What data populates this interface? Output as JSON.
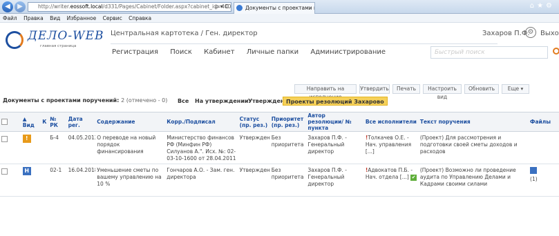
{
  "browser": {
    "url_prefix": "http://writer.",
    "url_domain": "eossoft.local",
    "url_rest": "/d331/Pages/Cabinet/Folder.aspx?cabinet_id=4000&card_id=0.8fc",
    "addr_icons": "ρ ▾ C",
    "tab_title": "Документы с проектами п...",
    "tab_close": "×",
    "tool_icons": "⌂★⚙"
  },
  "menu": [
    "Файл",
    "Правка",
    "Вид",
    "Избранное",
    "Сервис",
    "Справка"
  ],
  "header": {
    "logo_text": "ДЕЛО-WEB",
    "logo_sub": "главная страница",
    "card_title": "Центральная картотека / Ген. директор",
    "user_name": "Захаров П.Ф.",
    "exit_label": "Выход",
    "gear_glyph": "⚙",
    "nav": [
      "Регистрация",
      "Поиск",
      "Кабинет",
      "Личные папки",
      "Администрирование"
    ],
    "search_placeholder": "Быстрый поиск"
  },
  "actions": [
    "Направить на исполнение",
    "Утвердить",
    "Печать",
    "Настроить вид",
    "Обновить",
    "Еще ▾"
  ],
  "doc_bar": {
    "title": "Документы с проектами поручений:",
    "count": "2 (отмечено - 0)",
    "filters": [
      "Все",
      "На утверждении",
      "Утверждено",
      "Проекты резолюций Захарово"
    ]
  },
  "table": {
    "columns": [
      "",
      "▲ Вид",
      "К",
      "№ РК",
      "Дата рег.",
      "Содержание",
      "Корр./Подписал",
      "Статус (пр. рез.)",
      "Приоритет (пр. рез.)",
      "Автор резолюции/ № пункта",
      "Все исполнители",
      "Текст поручения",
      "Файлы"
    ],
    "rows": [
      {
        "icon": "!",
        "k": "",
        "rk": "Б-4",
        "date": "04.05.2012",
        "content": "О переводе на новый порядок финансирования",
        "corr": "Министерство финансов РФ (Минфин РФ) Силуанов А.\". Исх. №: 02-03-10-1600 от 28.04.2011",
        "status": "Утвержден",
        "priority": "Без приоритета",
        "author": "Захаров П.Ф. - Генеральный директор",
        "exec_mark": "!",
        "exec": "Толкачев О.Е. - Нач. управления [...]",
        "text": "(Проект) Для рассмотрения и подготовки своей сметы доходов и расходов",
        "files": ""
      },
      {
        "icon": "Н",
        "k": "",
        "rk": "02-1",
        "date": "16.04.2018",
        "content": "Уменьшение сметы по вашему управлению на 10 %",
        "corr": "Гончаров А.О. - Зам. ген. директора",
        "status": "Утвержден",
        "priority": "Без приоритета",
        "author": "Захаров П.Ф. - Генеральный директор",
        "exec_mark": "!",
        "exec": "Адвокатов П.Б. - Нач. отдела [...]",
        "text": "(Проект) Возможно ли проведение аудита по Управлению Делами и Кадрами своими силами",
        "files": "(1)"
      }
    ]
  }
}
